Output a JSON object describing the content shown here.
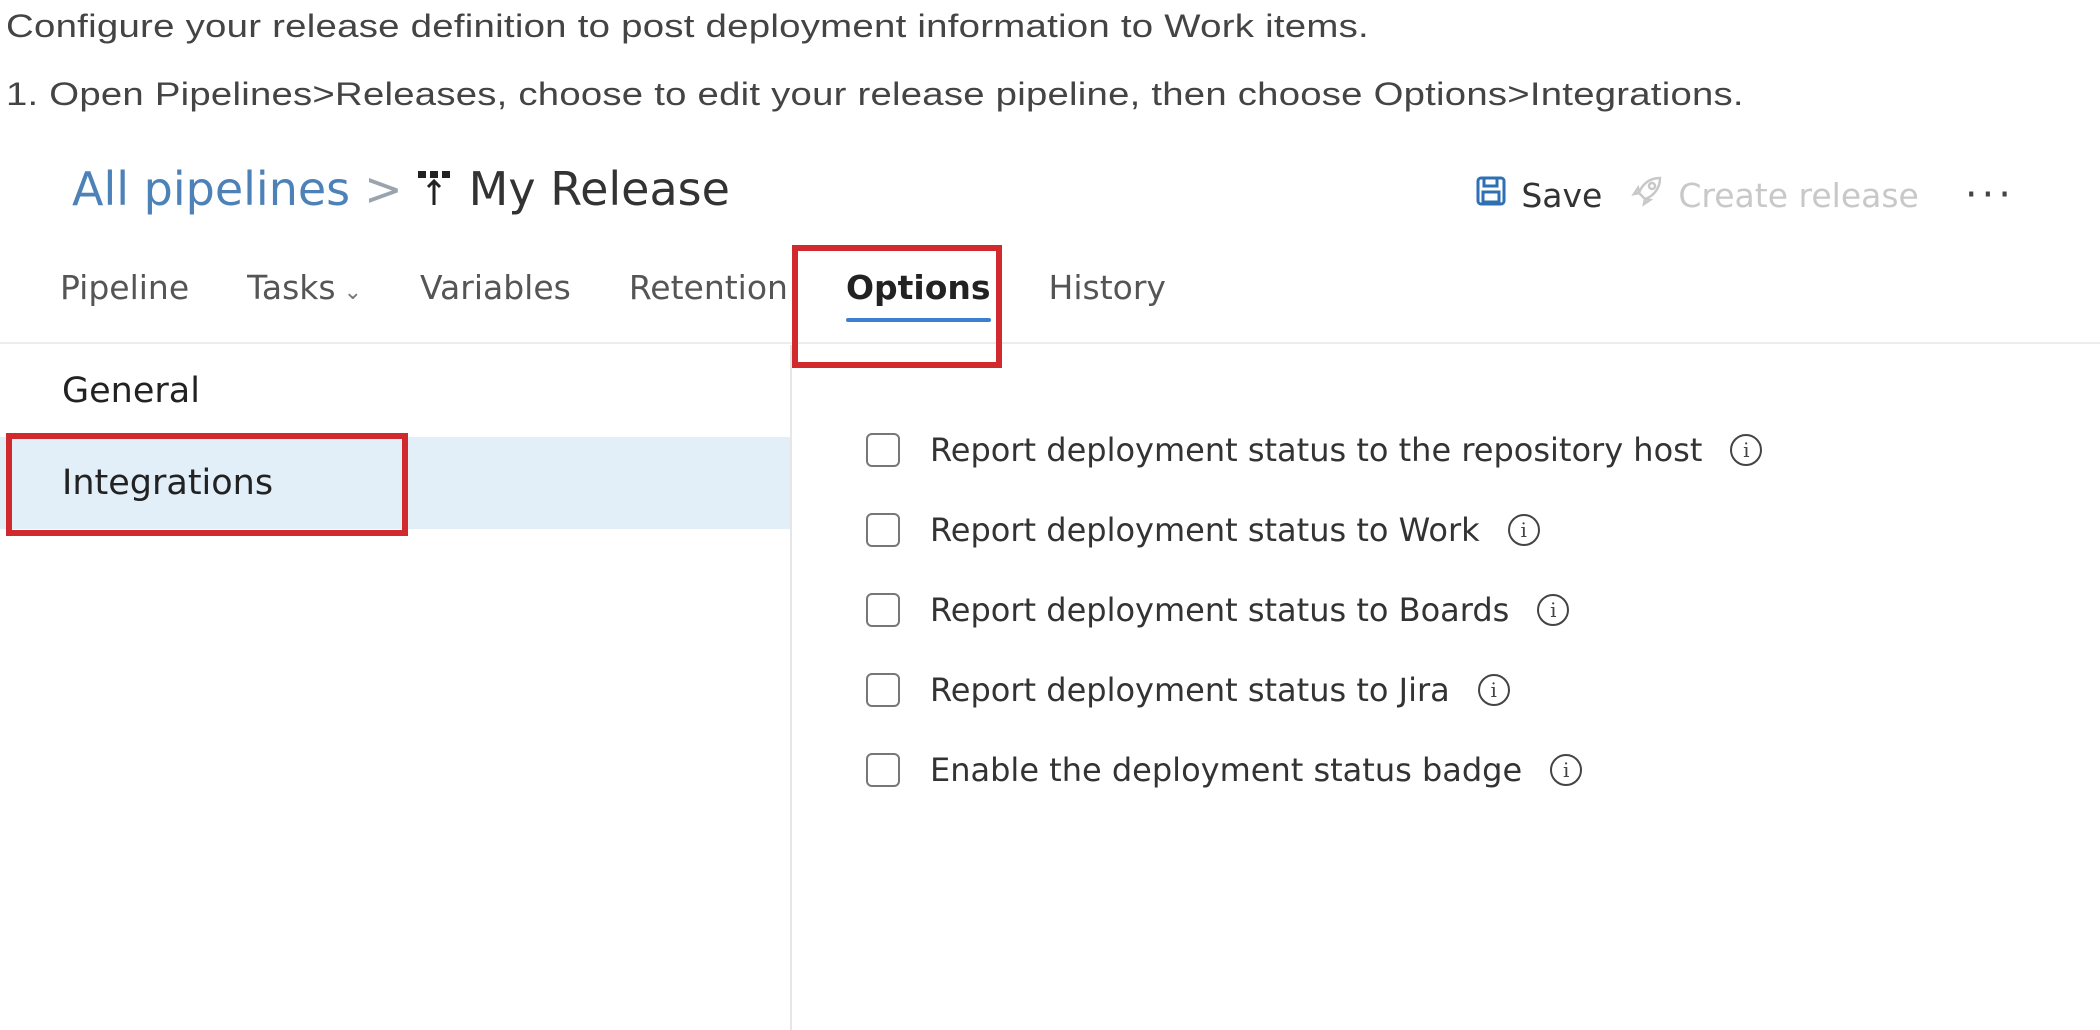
{
  "intro": {
    "line1": "Configure your release definition to post deployment information to Work items.",
    "line2": "1. Open Pipelines>Releases, choose to edit your release pipeline, then choose Options>Integrations."
  },
  "header": {
    "breadcrumb_root": "All pipelines",
    "separator": ">",
    "title": "My Release",
    "title_icon": "release-pipeline-icon"
  },
  "toolbar": {
    "save_label": "Save",
    "save_icon": "save-icon",
    "create_release_label": "Create release",
    "create_release_icon": "rocket-icon",
    "more_label": "···"
  },
  "tabs": [
    {
      "label": "Pipeline"
    },
    {
      "label": "Tasks",
      "has_dropdown": true
    },
    {
      "label": "Variables"
    },
    {
      "label": "Retention"
    },
    {
      "label": "Options",
      "active": true
    },
    {
      "label": "History"
    }
  ],
  "sidebar": {
    "items": [
      {
        "label": "General"
      },
      {
        "label": "Integrations",
        "selected": true
      }
    ]
  },
  "options": [
    {
      "label": "Report deployment status to the repository host",
      "checked": false
    },
    {
      "label": "Report deployment status to Work",
      "checked": false
    },
    {
      "label": "Report deployment status to Boards",
      "checked": false
    },
    {
      "label": "Report deployment status to Jira",
      "checked": false
    },
    {
      "label": "Enable the deployment status badge",
      "checked": false
    }
  ],
  "colors": {
    "accent": "#3a7fd0",
    "highlight": "#d02a2f",
    "selected_bg": "#e2eef8",
    "link": "#4d82b8"
  }
}
